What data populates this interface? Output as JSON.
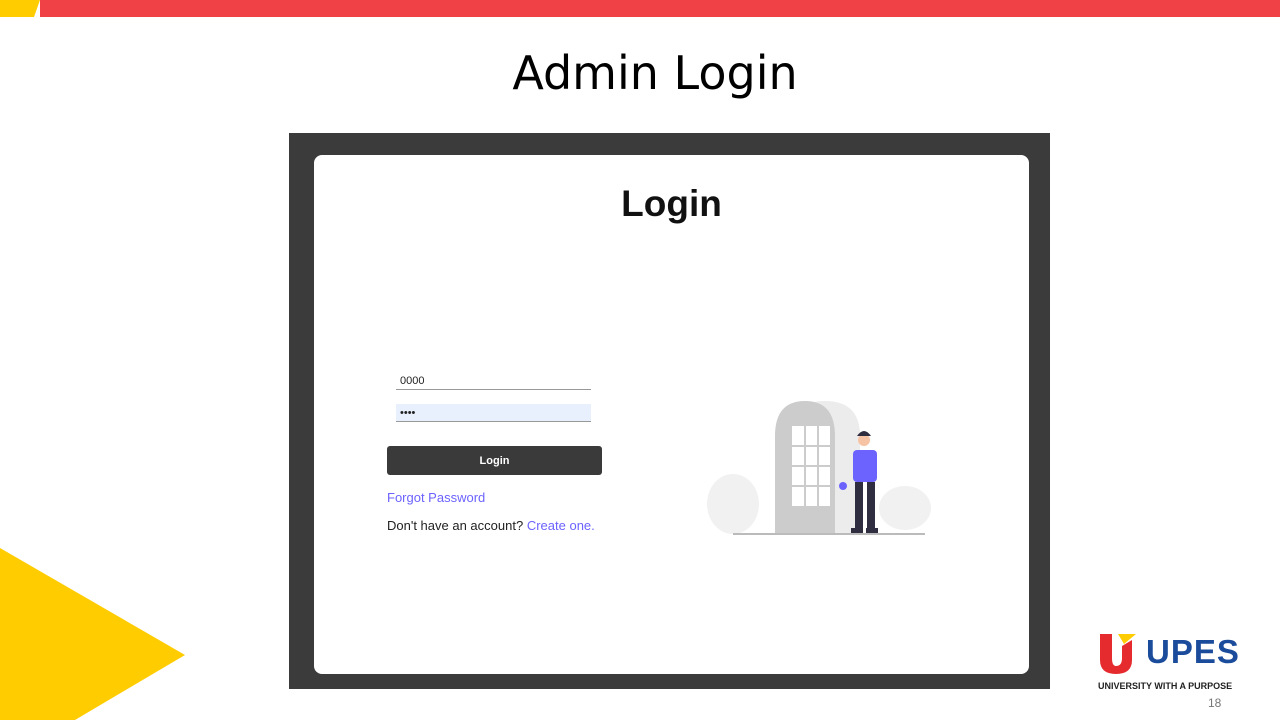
{
  "slide": {
    "title": "Admin Login",
    "page_number": "18"
  },
  "login_form": {
    "heading": "Login",
    "username_value": "0000",
    "password_value": "••••",
    "login_button": "Login",
    "forgot_password": "Forgot Password",
    "signup_prompt": "Don't have an account?",
    "signup_link": "Create one."
  },
  "branding": {
    "logo_name": "UPES",
    "tagline": "UNIVERSITY WITH A PURPOSE"
  },
  "colors": {
    "red": "#f04146",
    "yellow": "#ffcc00",
    "purple": "#6c63ff",
    "blue": "#1b4c9b",
    "dark": "#3b3b3b"
  }
}
